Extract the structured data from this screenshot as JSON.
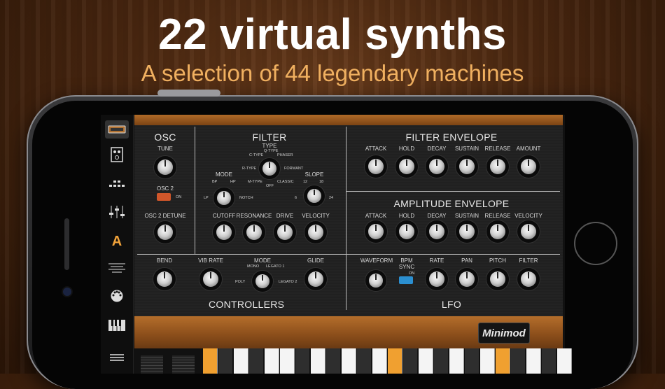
{
  "hero": {
    "title": "22 virtual synths",
    "subtitle": "A selection of 44 legendary machines"
  },
  "colors": {
    "accent": "#f0a030",
    "panel": "#202020",
    "wood": "#8a4d1a"
  },
  "sidebar": {
    "items": [
      {
        "icon": "synth-icon"
      },
      {
        "icon": "module-icon"
      },
      {
        "icon": "sequencer-icon"
      },
      {
        "icon": "mixer-icon"
      },
      {
        "icon": "A"
      },
      {
        "icon": "lines-icon"
      },
      {
        "icon": "midi-icon"
      },
      {
        "icon": "keyboard-icon"
      },
      {
        "icon": "menu-icon"
      }
    ]
  },
  "synth": {
    "name": "Minimod",
    "osc": {
      "title": "OSC",
      "tune": "TUNE",
      "osc2": "OSC 2",
      "on": "ON",
      "osc2_detune": "OSC 2 DETUNE"
    },
    "filter": {
      "title": "FILTER",
      "type": "TYPE",
      "type_opts": {
        "c": "C-TYPE",
        "q": "Q-TYPE",
        "phaser": "PHASER",
        "r": "R-TYPE",
        "formant": "FORMANT",
        "m": "M-TYPE",
        "off": "OFF",
        "classic": "CLASSIC"
      },
      "mode": "MODE",
      "mode_opts": {
        "bp": "BP",
        "hp": "HP",
        "lp": "LP",
        "notch": "NOTCH"
      },
      "slope": "SLOPE",
      "slope_opts": {
        "s12": "12",
        "s18": "18",
        "s6": "6",
        "s24": "24"
      },
      "cutoff": "CUTOFF",
      "resonance": "RESONANCE",
      "drive": "DRIVE",
      "velocity": "VELOCITY"
    },
    "filter_env": {
      "title": "FILTER ENVELOPE",
      "labels": [
        "ATTACK",
        "HOLD",
        "DECAY",
        "SUSTAIN",
        "RELEASE",
        "AMOUNT"
      ]
    },
    "amp_env": {
      "title": "AMPLITUDE ENVELOPE",
      "labels": [
        "ATTACK",
        "HOLD",
        "DECAY",
        "SUSTAIN",
        "RELEASE",
        "VELOCITY"
      ]
    },
    "controllers": {
      "title": "CONTROLLERS",
      "bend": "BEND",
      "vib_rate": "VIB RATE",
      "mode": "MODE",
      "glide": "GLIDE",
      "mode_opts": {
        "mono": "MONO",
        "legato1": "LEGATO 1",
        "poly": "POLY",
        "legato2": "LEGATO 2"
      }
    },
    "lfo": {
      "title": "LFO",
      "waveform": "WAVEFORM",
      "bpm_sync": "BPM\nSYNC",
      "on": "ON",
      "labels": [
        "RATE",
        "PAN",
        "PITCH",
        "FILTER"
      ]
    }
  }
}
